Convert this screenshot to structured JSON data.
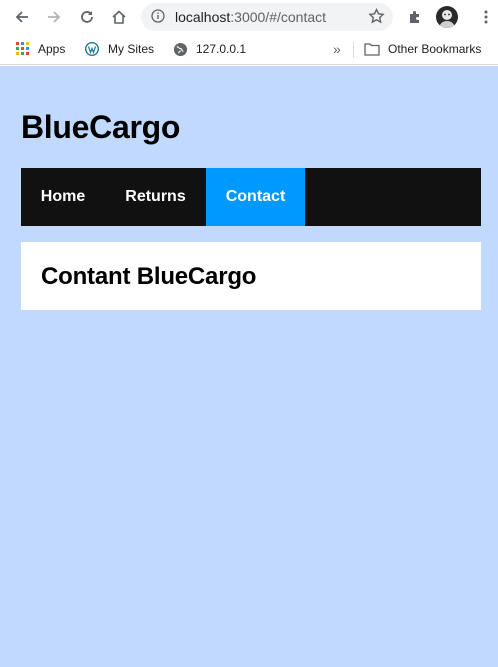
{
  "browser": {
    "url_host": "localhost",
    "url_path": ":3000/#/contact",
    "bookmarks": [
      {
        "label": "Apps",
        "icon": "apps-grid-icon"
      },
      {
        "label": "My Sites",
        "icon": "wordpress-icon"
      },
      {
        "label": "127.0.0.1",
        "icon": "globe-icon"
      }
    ],
    "overflow_label": "»",
    "other_bookmarks_label": "Other Bookmarks"
  },
  "page": {
    "site_title": "BlueCargo",
    "nav": [
      {
        "label": "Home",
        "active": false
      },
      {
        "label": "Returns",
        "active": false
      },
      {
        "label": "Contact",
        "active": true
      }
    ],
    "heading": "Contant BlueCargo"
  },
  "colors": {
    "page_background": "#c1d9fd",
    "nav_background": "#111111",
    "nav_active": "#0099ff"
  }
}
